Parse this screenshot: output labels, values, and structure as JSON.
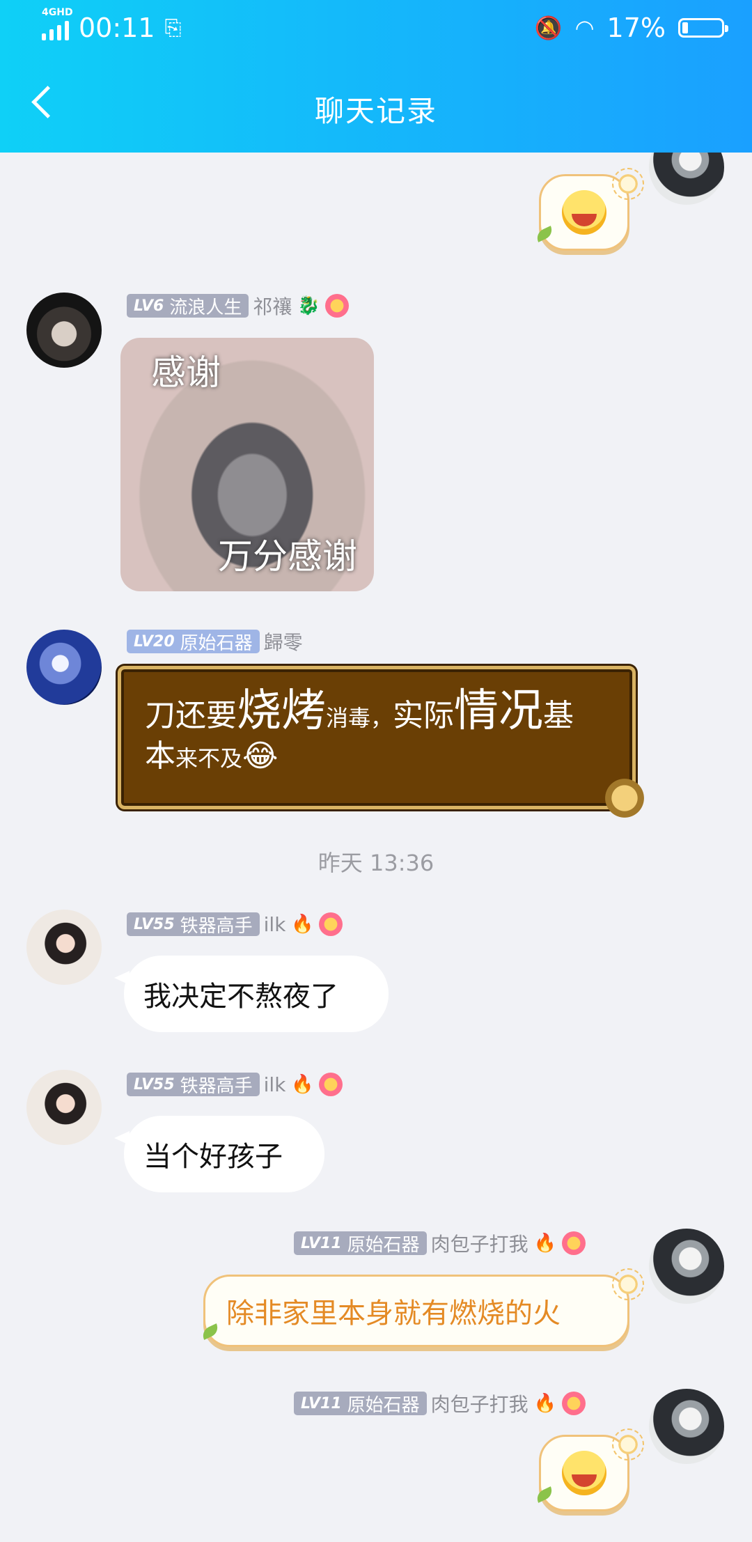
{
  "status_bar": {
    "time": "00:11",
    "network": "4GHD",
    "battery": "17%"
  },
  "header": {
    "title": "聊天记录"
  },
  "messages": [
    {
      "type": "sticker",
      "side": "right",
      "sticker": "tongue-out-emoji"
    },
    {
      "badge_level": "LV6",
      "badge_title": "流浪人生",
      "nickname": "祁禳",
      "image_text_top": "感谢",
      "image_text_bottom": "万分感谢"
    },
    {
      "badge_level": "LV20",
      "badge_title": "原始石器",
      "nickname": "歸零",
      "text_parts": [
        "刀还要",
        "烧烤",
        "消毒，",
        "实际",
        "情况",
        "基",
        "本",
        "来不及",
        "😂"
      ]
    },
    {
      "timestamp": "昨天 13:36"
    },
    {
      "badge_level": "LV55",
      "badge_title": "铁器高手",
      "nickname": "ilk",
      "text": "我决定不熬夜了"
    },
    {
      "badge_level": "LV55",
      "badge_title": "铁器高手",
      "nickname": "ilk",
      "text": "当个好孩子"
    },
    {
      "badge_level": "LV11",
      "badge_title": "原始石器",
      "nickname": "肉包子打我",
      "text": "除非家里本身就有燃烧的火"
    },
    {
      "badge_level": "LV11",
      "badge_title": "原始石器",
      "nickname": "肉包子打我",
      "sticker": "tongue-out-emoji"
    }
  ]
}
